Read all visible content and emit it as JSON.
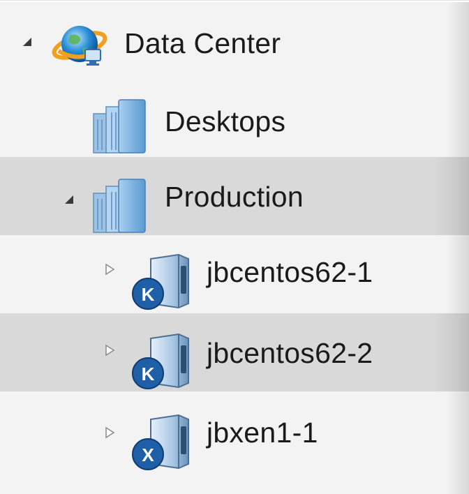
{
  "tree": {
    "root": {
      "label": "Data Center",
      "icon": "datacenter-globe-icon",
      "expanded": true
    },
    "items": [
      {
        "label": "Desktops",
        "icon": "folder-icon",
        "expanded": null,
        "selected": false
      },
      {
        "label": "Production",
        "icon": "folder-icon",
        "expanded": true,
        "selected": true
      },
      {
        "label": "jbcentos62-1",
        "icon": "kvm-host-icon",
        "badge": "K",
        "expanded": false,
        "selected": false
      },
      {
        "label": "jbcentos62-2",
        "icon": "kvm-host-icon",
        "badge": "K",
        "expanded": false,
        "selected": true
      },
      {
        "label": "jbxen1-1",
        "icon": "xen-host-icon",
        "badge": "X",
        "expanded": false,
        "selected": false
      }
    ]
  },
  "colors": {
    "selection": "#d9d9d9",
    "badge": "#1f5fa8",
    "folder": "#5aa0d8",
    "globe": "#2a8fd6",
    "orbit": "#f0a020"
  }
}
